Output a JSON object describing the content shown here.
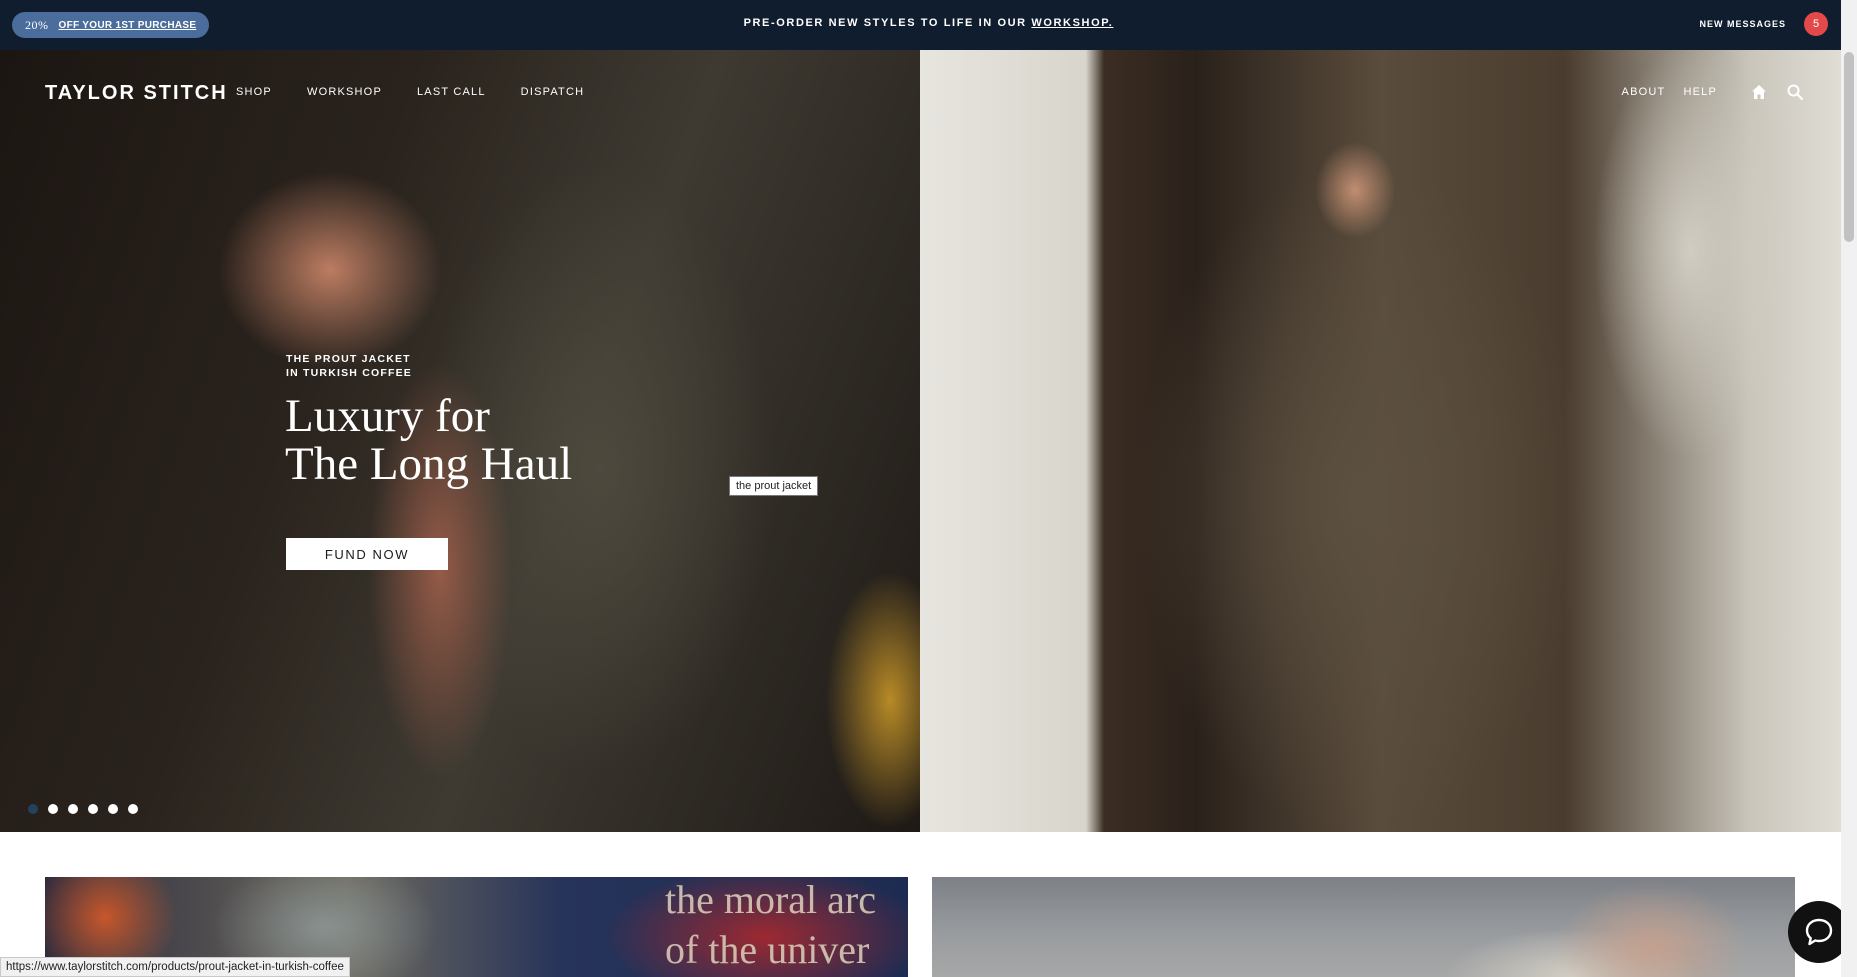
{
  "announcement": {
    "promo_percent": "20%",
    "promo_link": "OFF YOUR 1ST PURCHASE",
    "text_prefix": "PRE-ORDER NEW STYLES TO LIFE IN OUR ",
    "text_link": "WORKSHOP.",
    "messages_label": "NEW  MESSAGES",
    "messages_count": "5"
  },
  "header": {
    "logo": "TAYLOR STITCH",
    "nav_left": [
      "SHOP",
      "WORKSHOP",
      "LAST CALL",
      "DISPATCH"
    ],
    "nav_right": [
      "ABOUT",
      "HELP"
    ],
    "icons": [
      "home-icon",
      "search-icon"
    ]
  },
  "hero": {
    "eyebrow_line1": "THE PROUT JACKET",
    "eyebrow_line2": "IN TURKISH COFFEE",
    "headline_line1": "Luxury for",
    "headline_line2": "The Long Haul",
    "cta_label": "FUND NOW",
    "tooltip": "the prout jacket",
    "slides_count": 6,
    "active_slide": 1
  },
  "cards": {
    "left_art_text_line1": "the moral arc",
    "left_art_text_line2": "of the univer"
  },
  "status_bar": {
    "url": "https://www.taylorstitch.com/products/prout-jacket-in-turkish-coffee"
  },
  "colors": {
    "topbar_bg": "#0f1d2e",
    "promo_pill": "#4a6d9b",
    "badge_red": "#e24a4a",
    "active_dot": "#24425e"
  }
}
